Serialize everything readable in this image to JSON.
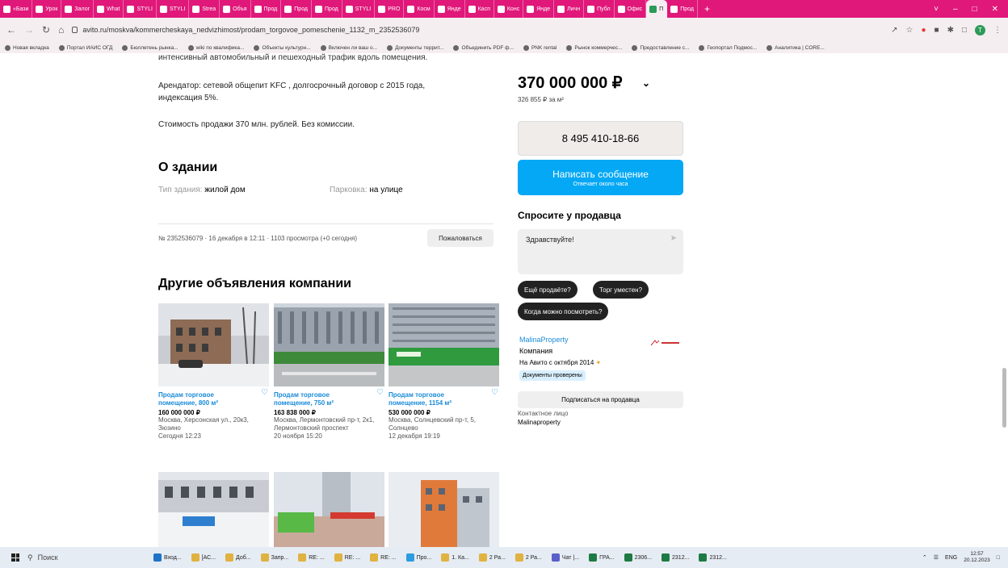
{
  "browser": {
    "tabs": [
      "«Бази",
      "Урок",
      "Залог",
      "What",
      "STYLI",
      "STYLI",
      "Strea",
      "Объя",
      "Прод",
      "Прод",
      "Прод",
      "STYLI",
      "PRO",
      "Косм",
      "Янде",
      "Касп",
      "Конс",
      "Янде",
      "Личн",
      "Публ",
      "Офис",
      "П",
      "Прод"
    ],
    "active_tab_index": 21,
    "new_tab": "+",
    "url": "avito.ru/moskva/kommercheskaya_nedvizhimost/prodam_torgovoe_pomeschenie_1132_m_2352536079",
    "profile_initial": "T",
    "bookmarks": [
      "Новая вкладка",
      "Портал ИАИС ОГД",
      "Бюллетень рынка...",
      "wiki по квалифика...",
      "Объекты культурн...",
      "Включен ли ваш о...",
      "Документы террит...",
      "Объединить PDF ф...",
      "PNK rental",
      "Рынок коммерчес...",
      "Предоставление с...",
      "Геопортал Подмос...",
      "Аналитика | CORE..."
    ],
    "colors": {
      "tabbar": "#e0187a",
      "accent": "#04a8f5",
      "link": "#1a8bd9"
    }
  },
  "listing": {
    "cut_line": "интенсивный автомобильный и пешеходный трафик вдоль помещения.",
    "description_1": "Арендатор: сетевой общепит KFC , долгосрочный договор с 2015 года, индексация 5%.",
    "description_2": "Стоимость продажи 370 млн. рублей. Без комиссии.",
    "about_heading": "О здании",
    "building_type_label": "Тип здания:",
    "building_type_value": "жилой дом",
    "parking_label": "Парковка:",
    "parking_value": "на улице",
    "meta": "№ 2352536079 · 16 декабря в 12:11 · 1103 просмотра (+0 сегодня)",
    "report_button": "Пожаловаться",
    "other_heading": "Другие объявления компании",
    "cards": [
      {
        "title": "Продам торговое помещение, 800 м²",
        "price": "160 000 000 ₽",
        "address": "Москва, Херсонская ул., 20к3, Зюзино",
        "date": "Сегодня 12:23"
      },
      {
        "title": "Продам торговое помещение, 750 м²",
        "price": "163 838 000 ₽",
        "address": "Москва, Лермонтовский пр-т, 2к1, Лермонтовский проспект",
        "date": "20 ноября 15:20"
      },
      {
        "title": "Продам торговое помещение, 1154 м²",
        "price": "530 000 000 ₽",
        "address": "Москва, Солнцевский пр-т, 5, Солнцево",
        "date": "12 декабря 19:19"
      }
    ]
  },
  "sidebar": {
    "price": "370 000 000 ₽",
    "price_per_m": "326 855 ₽ за м²",
    "phone": "8 495 410-18-66",
    "message_button": "Написать сообщение",
    "message_sub": "Отвечает около часа",
    "ask_heading": "Спросите у продавца",
    "ask_input": "Здравствуйте!",
    "chips": [
      "Ещё продаёте?",
      "Торг уместен?",
      "Когда можно посмотреть?"
    ],
    "seller_name": "MalinaProperty",
    "seller_type": "Компания",
    "seller_since": "На Авито с октября 2014",
    "verified_badge": "Документы проверены",
    "subscribe_button": "Подписаться на продавца",
    "contact_label": "Контактное лицо",
    "contact_value": "Malinaproperty"
  },
  "taskbar": {
    "search": "Поиск",
    "items": [
      "Вход...",
      "[АС...",
      "Доб...",
      "Запр...",
      "RE: ...",
      "RE: ...",
      "RE: ...",
      "Про...",
      "1. Ка...",
      "2 Ра...",
      "2 Ра...",
      "Чат |...",
      "ГРА...",
      "2306...",
      "2312...",
      "2312..."
    ],
    "lang": "ENG",
    "time": "12:57",
    "date": "20.12.2023"
  }
}
